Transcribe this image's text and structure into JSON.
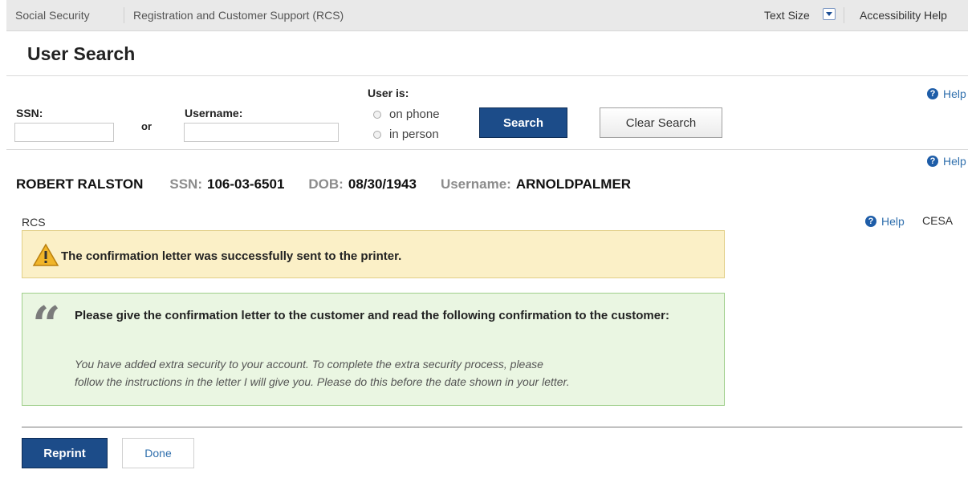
{
  "topbar": {
    "breadcrumbs": [
      "Social Security",
      "Registration and Customer Support (RCS)"
    ],
    "text_size_label": "Text Size",
    "accessibility_help": "Accessibility Help"
  },
  "page_title": "User Search",
  "search": {
    "ssn_label": "SSN:",
    "ssn_value": "",
    "or_label": "or",
    "username_label": "Username:",
    "username_value": "",
    "user_is_label": "User is:",
    "options": [
      "on phone",
      "in person"
    ],
    "search_button": "Search",
    "clear_button": "Clear Search",
    "help": "Help"
  },
  "user": {
    "name": "ROBERT RALSTON",
    "ssn_label": "SSN:",
    "ssn": "106-03-6501",
    "dob_label": "DOB:",
    "dob": "08/30/1943",
    "username_label": "Username:",
    "username": "ARNOLDPALMER",
    "help": "Help"
  },
  "section": {
    "left_label": "RCS",
    "help": "Help",
    "right_label": "CESA"
  },
  "alert": {
    "icon": "warning-icon",
    "message": "The confirmation letter was successfully sent to the printer."
  },
  "confirmation": {
    "quote_glyph": "“",
    "heading": "Please give the confirmation letter to the customer and read the following confirmation to the customer:",
    "line1": "You have added extra security to your account. To complete the extra security process, please",
    "line2": "follow the instructions in the letter I will give you. Please do this before the date shown in your letter."
  },
  "actions": {
    "reprint": "Reprint",
    "done": "Done"
  },
  "colors": {
    "primary_button": "#1c4c89",
    "warning_bg": "#fbf0c7",
    "confirm_bg": "#eaf6e2",
    "help_link": "#2f6fad"
  }
}
